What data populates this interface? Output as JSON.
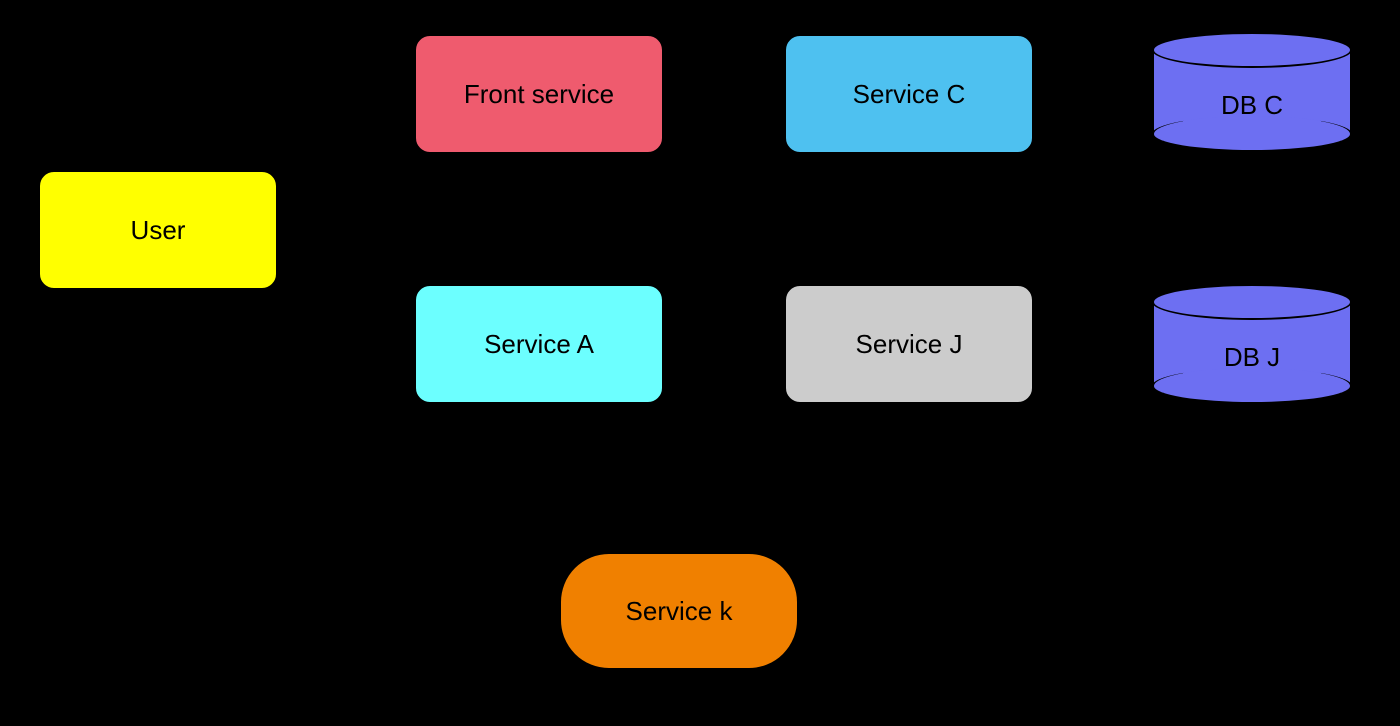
{
  "nodes": {
    "user": {
      "label": "User",
      "color": "#FFFF00"
    },
    "front_service": {
      "label": "Front service",
      "color": "#EF5B6E"
    },
    "service_a": {
      "label": "Service A",
      "color": "#6CFFFF"
    },
    "service_c": {
      "label": "Service C",
      "color": "#4EC1F0"
    },
    "service_j": {
      "label": "Service J",
      "color": "#CCCCCC"
    },
    "service_k": {
      "label": "Service k",
      "color": "#F08000"
    },
    "db_c": {
      "label": "DB C",
      "color": "#6D6FF2"
    },
    "db_j": {
      "label": "DB J",
      "color": "#6D6FF2"
    }
  }
}
